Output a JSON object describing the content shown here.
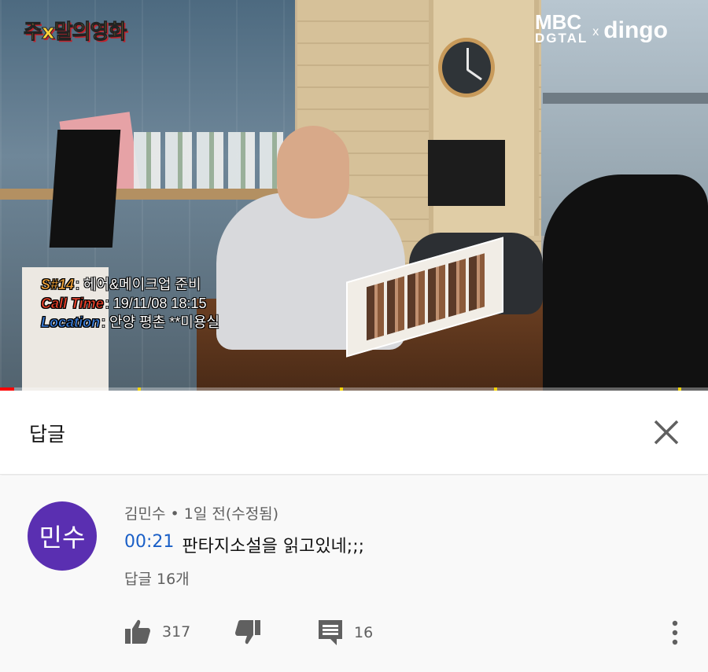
{
  "video": {
    "channel_logo": "주x말의영화",
    "brand_logo": {
      "mbc_top": "MBC",
      "mbc_bottom": "DGTAL",
      "separator": "x",
      "partner": "dingo"
    },
    "caption": {
      "scene_key": "S#14",
      "scene_value": ": 헤어&메이크업 준비",
      "call_time_key": "Call Time",
      "call_time_value": ": 19/11/08 18:15",
      "location_key": "Location",
      "location_value": ": 안양 평촌 **미용실",
      "colors": {
        "scene": "#f2a33a",
        "call_time": "#e8412b",
        "location": "#3a7bd5"
      }
    },
    "progress_fraction": 0.02
  },
  "panel": {
    "title": "답글",
    "close_icon": "close-icon"
  },
  "comment": {
    "avatar_text": "민수",
    "avatar_color": "#5a2fb1",
    "meta": "김민수 • 1일 전(수정됨)",
    "timestamp": "00:21",
    "text": "판타지소설을 읽고있네;;;",
    "replies": "답글 16개",
    "likes": "317",
    "reply_action_count": "16",
    "icons": [
      "thumb-up-icon",
      "thumb-down-icon",
      "reply-icon",
      "more-vert-icon"
    ]
  }
}
